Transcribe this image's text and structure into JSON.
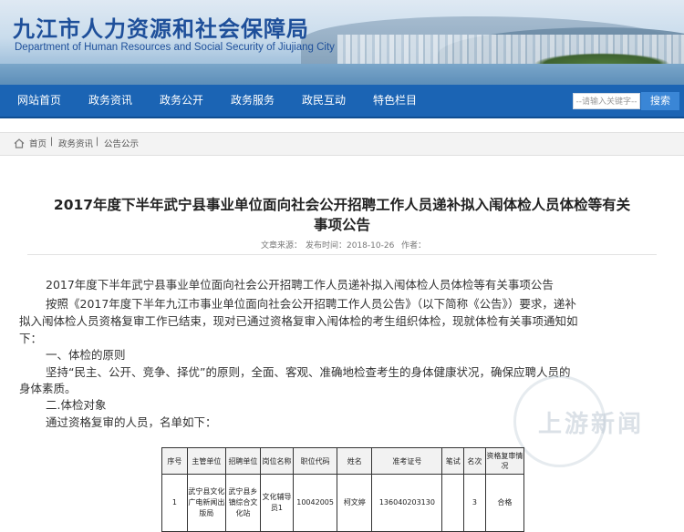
{
  "header": {
    "title": "九江市人力资源和社会保障局",
    "subtitle": "Department of Human Resources and Social Security of Jiujiang City"
  },
  "nav": {
    "items": [
      "网站首页",
      "政务资讯",
      "政务公开",
      "政务服务",
      "政民互动",
      "特色栏目"
    ],
    "search_placeholder": "--请输入关键字--",
    "search_button": "搜索"
  },
  "breadcrumb": [
    "首页",
    "政务资讯",
    "公告公示"
  ],
  "article": {
    "title_line1": "2017年度下半年武宁县事业单位面向社会公开招聘工作人员递补拟入闱体检人员体检等有关",
    "title_line2": "事项公告",
    "meta_source": "文章来源：",
    "meta_date": "发布时间：2018-10-26",
    "meta_author": "作者：",
    "paragraphs": [
      "2017年度下半年武宁县事业单位面向社会公开招聘工作人员递补拟入闱体检人员体检等有关事项公告",
      "按照《2017年度下半年九江市事业单位面向社会公开招聘工作人员公告》（以下简称《公告》）要求，递补",
      "拟入闱体检人员资格复审工作已结束，现对已通过资格复审入闱体检的考生组织体检，现就体检有关事项通知如",
      "下：",
      "一、体检的原则",
      "坚持“民主、公开、竞争、择优”的原则，全面、客观、准确地检查考生的身体健康状况，确保应聘人员的",
      "身体素质。",
      "二.体检对象",
      "通过资格复审的人员，名单如下："
    ]
  },
  "table": {
    "headers": [
      "序号",
      "主管单位",
      "招聘单位",
      "岗位名称",
      "职位代码",
      "姓名",
      "准考证号",
      "笔试",
      "名次",
      "资格复审情况"
    ],
    "rows": [
      [
        "1",
        "武宁县文化广电新闻出版局",
        "武宁县乡镇综合文化站",
        "文化辅导员1",
        "10042005",
        "柯文婷",
        "136040203130",
        "",
        "3",
        "合格"
      ]
    ]
  },
  "watermark": "上游新闻"
}
